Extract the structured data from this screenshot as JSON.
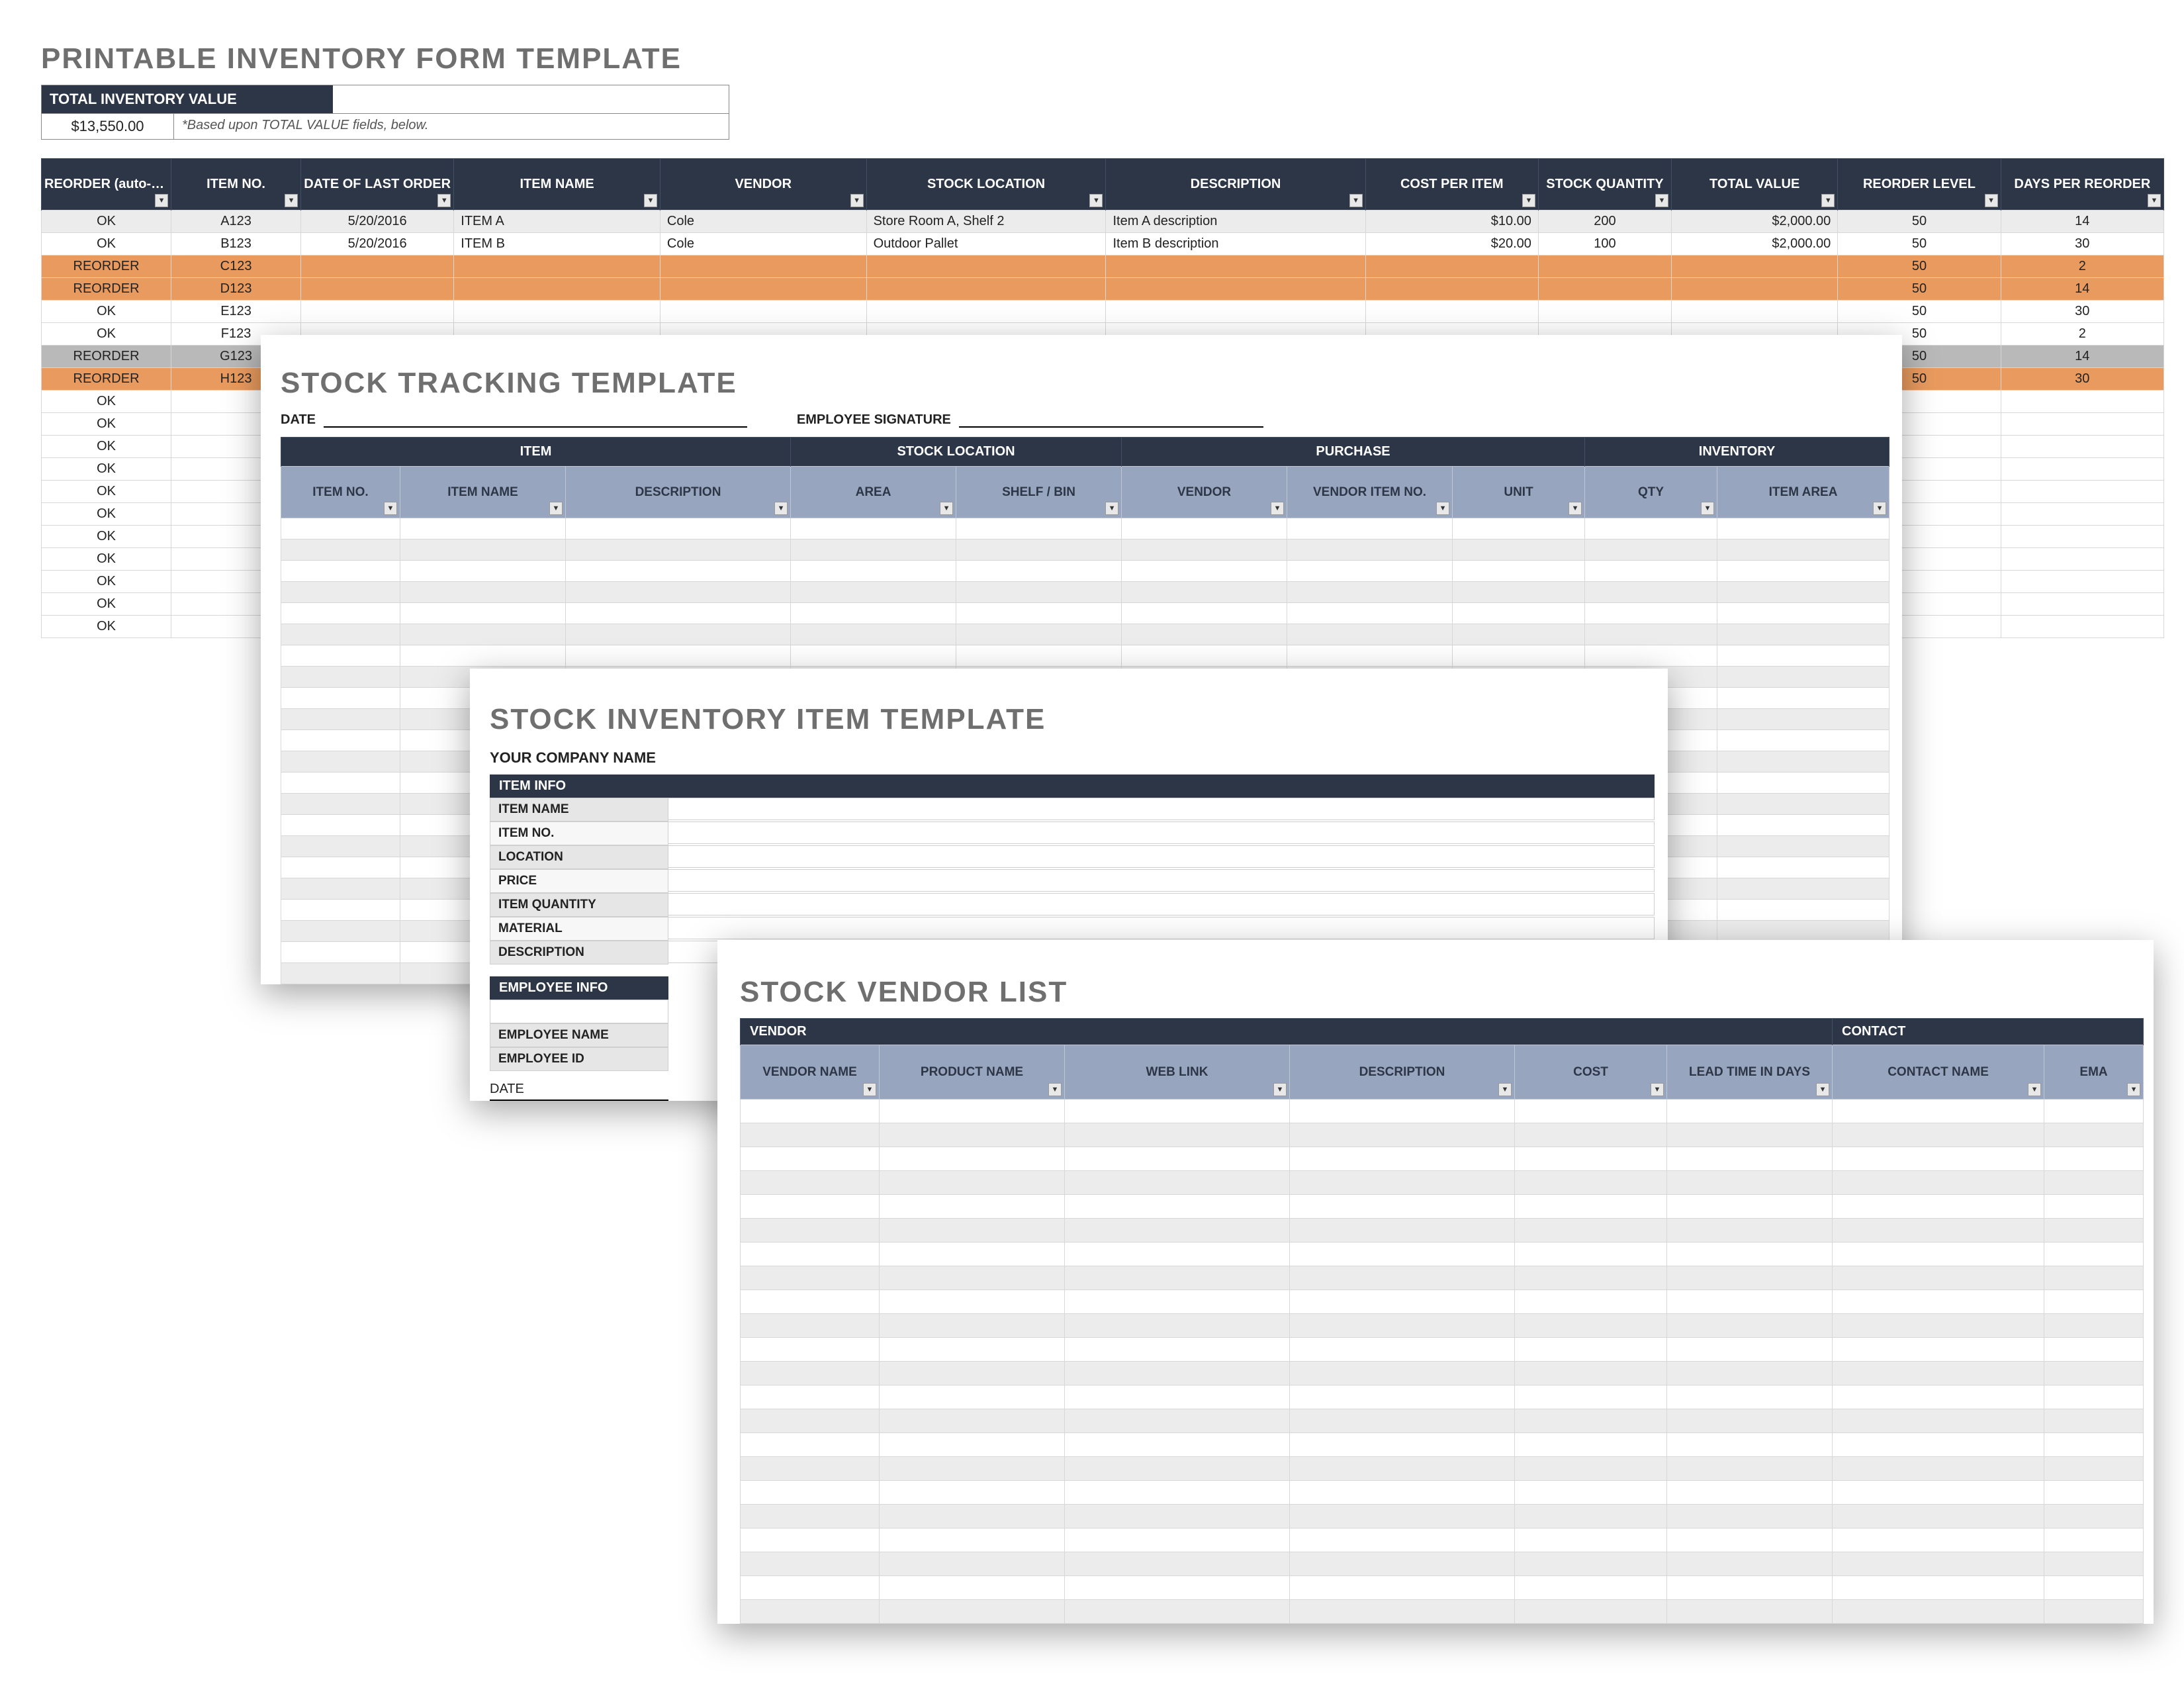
{
  "p1": {
    "title": "PRINTABLE INVENTORY FORM TEMPLATE",
    "tiv_label": "TOTAL INVENTORY VALUE",
    "tiv_value": "$13,550.00",
    "tiv_note": "*Based upon TOTAL VALUE fields, below.",
    "cols": [
      "REORDER (auto-fill)",
      "ITEM NO.",
      "DATE OF LAST ORDER",
      "ITEM NAME",
      "VENDOR",
      "STOCK LOCATION",
      "DESCRIPTION",
      "COST PER ITEM",
      "STOCK QUANTITY",
      "TOTAL VALUE",
      "REORDER LEVEL",
      "DAYS PER REORDER"
    ],
    "rows": [
      {
        "status": "OK",
        "class": "alt",
        "item": "A123",
        "date": "5/20/2016",
        "name": "ITEM A",
        "vendor": "Cole",
        "loc": "Store Room A, Shelf 2",
        "desc": "Item A description",
        "cost": "$10.00",
        "qty": "200",
        "total": "$2,000.00",
        "rl": "50",
        "days": "14",
        "tail": ""
      },
      {
        "status": "OK",
        "class": "",
        "item": "B123",
        "date": "5/20/2016",
        "name": "ITEM B",
        "vendor": "Cole",
        "loc": "Outdoor Pallet",
        "desc": "Item B description",
        "cost": "$20.00",
        "qty": "100",
        "total": "$2,000.00",
        "rl": "50",
        "days": "30",
        "tail": ""
      },
      {
        "status": "REORDER",
        "class": "reorder",
        "item": "C123",
        "date": "",
        "name": "",
        "vendor": "",
        "loc": "",
        "desc": "",
        "cost": "",
        "qty": "",
        "total": "",
        "rl": "50",
        "days": "2",
        "tail": "reorder"
      },
      {
        "status": "REORDER",
        "class": "reorder",
        "item": "D123",
        "date": "",
        "name": "",
        "vendor": "",
        "loc": "",
        "desc": "",
        "cost": "",
        "qty": "",
        "total": "",
        "rl": "50",
        "days": "14",
        "tail": "reorder"
      },
      {
        "status": "OK",
        "class": "",
        "item": "E123",
        "date": "",
        "name": "",
        "vendor": "",
        "loc": "",
        "desc": "",
        "cost": "",
        "qty": "",
        "total": "",
        "rl": "50",
        "days": "30",
        "tail": ""
      },
      {
        "status": "OK",
        "class": "",
        "item": "F123",
        "date": "",
        "name": "",
        "vendor": "",
        "loc": "",
        "desc": "",
        "cost": "",
        "qty": "",
        "total": "",
        "rl": "50",
        "days": "2",
        "tail": ""
      },
      {
        "status": "REORDER",
        "class": "reorder-gray",
        "item": "G123",
        "date": "",
        "name": "",
        "vendor": "",
        "loc": "",
        "desc": "",
        "cost": "",
        "qty": "",
        "total": "",
        "rl": "50",
        "days": "14",
        "tail": "gray"
      },
      {
        "status": "REORDER",
        "class": "reorder",
        "item": "H123",
        "date": "",
        "name": "",
        "vendor": "",
        "loc": "",
        "desc": "",
        "cost": "",
        "qty": "",
        "total": "",
        "rl": "50",
        "days": "30",
        "tail": "reorder"
      },
      {
        "status": "OK",
        "class": "",
        "item": "",
        "date": "",
        "name": "",
        "vendor": "",
        "loc": "",
        "desc": "",
        "cost": "",
        "qty": "",
        "total": "",
        "rl": "",
        "days": "",
        "tail": ""
      },
      {
        "status": "OK",
        "class": "",
        "item": "",
        "date": "",
        "name": "",
        "vendor": "",
        "loc": "",
        "desc": "",
        "cost": "",
        "qty": "",
        "total": "",
        "rl": "",
        "days": "",
        "tail": ""
      },
      {
        "status": "OK",
        "class": "",
        "item": "",
        "date": "",
        "name": "",
        "vendor": "",
        "loc": "",
        "desc": "",
        "cost": "",
        "qty": "",
        "total": "",
        "rl": "",
        "days": "",
        "tail": ""
      },
      {
        "status": "OK",
        "class": "",
        "item": "",
        "date": "",
        "name": "",
        "vendor": "",
        "loc": "",
        "desc": "",
        "cost": "",
        "qty": "",
        "total": "",
        "rl": "",
        "days": "",
        "tail": ""
      },
      {
        "status": "OK",
        "class": "",
        "item": "",
        "date": "",
        "name": "",
        "vendor": "",
        "loc": "",
        "desc": "",
        "cost": "",
        "qty": "",
        "total": "",
        "rl": "",
        "days": "",
        "tail": ""
      },
      {
        "status": "OK",
        "class": "",
        "item": "",
        "date": "",
        "name": "",
        "vendor": "",
        "loc": "",
        "desc": "",
        "cost": "",
        "qty": "",
        "total": "",
        "rl": "",
        "days": "",
        "tail": ""
      },
      {
        "status": "OK",
        "class": "",
        "item": "",
        "date": "",
        "name": "",
        "vendor": "",
        "loc": "",
        "desc": "",
        "cost": "",
        "qty": "",
        "total": "",
        "rl": "",
        "days": "",
        "tail": ""
      },
      {
        "status": "OK",
        "class": "",
        "item": "",
        "date": "",
        "name": "",
        "vendor": "",
        "loc": "",
        "desc": "",
        "cost": "",
        "qty": "",
        "total": "",
        "rl": "",
        "days": "",
        "tail": ""
      },
      {
        "status": "OK",
        "class": "",
        "item": "",
        "date": "",
        "name": "",
        "vendor": "",
        "loc": "",
        "desc": "",
        "cost": "",
        "qty": "",
        "total": "",
        "rl": "",
        "days": "",
        "tail": ""
      },
      {
        "status": "OK",
        "class": "",
        "item": "",
        "date": "",
        "name": "",
        "vendor": "",
        "loc": "",
        "desc": "",
        "cost": "",
        "qty": "",
        "total": "",
        "rl": "",
        "days": "",
        "tail": ""
      },
      {
        "status": "OK",
        "class": "",
        "item": "",
        "date": "",
        "name": "",
        "vendor": "",
        "loc": "",
        "desc": "",
        "cost": "",
        "qty": "",
        "total": "",
        "rl": "",
        "days": "",
        "tail": ""
      }
    ]
  },
  "p2": {
    "title": "STOCK TRACKING TEMPLATE",
    "date_label": "DATE",
    "sig_label": "EMPLOYEE SIGNATURE",
    "groups": [
      "ITEM",
      "STOCK LOCATION",
      "PURCHASE",
      "INVENTORY"
    ],
    "cols": [
      "ITEM NO.",
      "ITEM NAME",
      "DESCRIPTION",
      "AREA",
      "SHELF / BIN",
      "VENDOR",
      "VENDOR ITEM NO.",
      "UNIT",
      "QTY",
      "ITEM AREA"
    ],
    "empty_rows": 22
  },
  "p3": {
    "title": "STOCK INVENTORY ITEM TEMPLATE",
    "company_label": "YOUR COMPANY NAME",
    "section1": "ITEM INFO",
    "fields1": [
      "ITEM NAME",
      "ITEM NO.",
      "LOCATION",
      "PRICE",
      "ITEM QUANTITY",
      "MATERIAL",
      "DESCRIPTION"
    ],
    "section2": "EMPLOYEE INFO",
    "fields2_blank": "",
    "fields2": [
      "EMPLOYEE NAME",
      "EMPLOYEE ID"
    ],
    "date_label": "DATE"
  },
  "p4": {
    "title": "STOCK VENDOR LIST",
    "groups": [
      "VENDOR",
      "CONTACT"
    ],
    "cols": [
      "VENDOR NAME",
      "PRODUCT NAME",
      "WEB LINK",
      "DESCRIPTION",
      "COST",
      "LEAD TIME IN DAYS",
      "CONTACT NAME",
      "EMA"
    ],
    "empty_rows": 22
  }
}
